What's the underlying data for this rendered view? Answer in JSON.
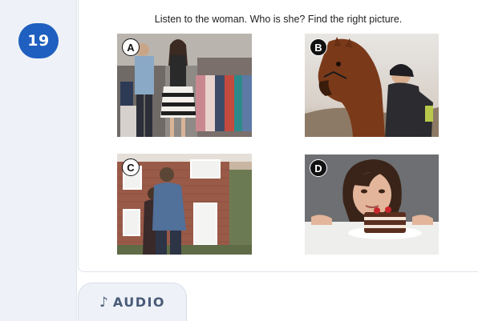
{
  "question": {
    "number": "19",
    "instruction": "Listen to the woman. Who is she? Find the right picture."
  },
  "options": [
    {
      "letter": "A",
      "icon": "shop-couple-photo"
    },
    {
      "letter": "B",
      "icon": "woman-horse-photo"
    },
    {
      "letter": "C",
      "icon": "couple-house-photo"
    },
    {
      "letter": "D",
      "icon": "woman-cake-photo"
    }
  ],
  "audio": {
    "icon": "♪",
    "label": "AUDIO"
  },
  "colors": {
    "badge": "#1f5fbf",
    "rail": "#eef2f8",
    "audio_text": "#4a5b78"
  }
}
